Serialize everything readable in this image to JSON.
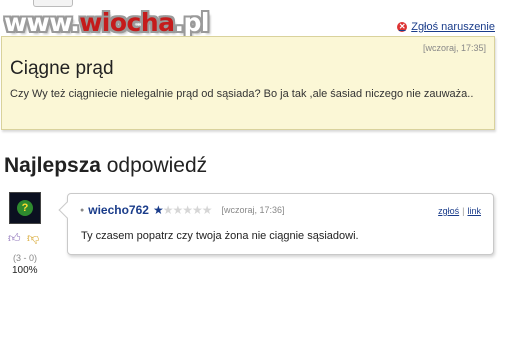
{
  "watermark": {
    "prefix": "www.",
    "brand": "wiocha",
    "suffix": ".pl"
  },
  "report": {
    "label": "Zgłoś naruszenie",
    "icon": "close-circle-icon"
  },
  "question": {
    "timestamp": "[wczoraj, 17:35]",
    "title": "Ciągne prąd",
    "body": "Czy Wy też ciągniecie nielegalnie prąd od sąsiada? Bo ja tak ,ale śasiad niczego nie zauważa.."
  },
  "best_answer": {
    "heading_bold": "Najlepsza",
    "heading_rest": " odpowiedź",
    "username": "wiecho762",
    "rating": {
      "stars_filled": 1,
      "stars_total": 6
    },
    "timestamp": "[wczoraj, 17:36]",
    "links": {
      "report": "zgłoś",
      "link": "link"
    },
    "text": "Ty czasem popatrz czy twoja żona nie ciągnie sąsiadowi.",
    "votes": {
      "count": "(3 - 0)",
      "percent": "100%"
    }
  },
  "colors": {
    "question_bg": "#fbf7d6",
    "link": "#1a3c8a",
    "watermark_red": "#c51b1b"
  }
}
